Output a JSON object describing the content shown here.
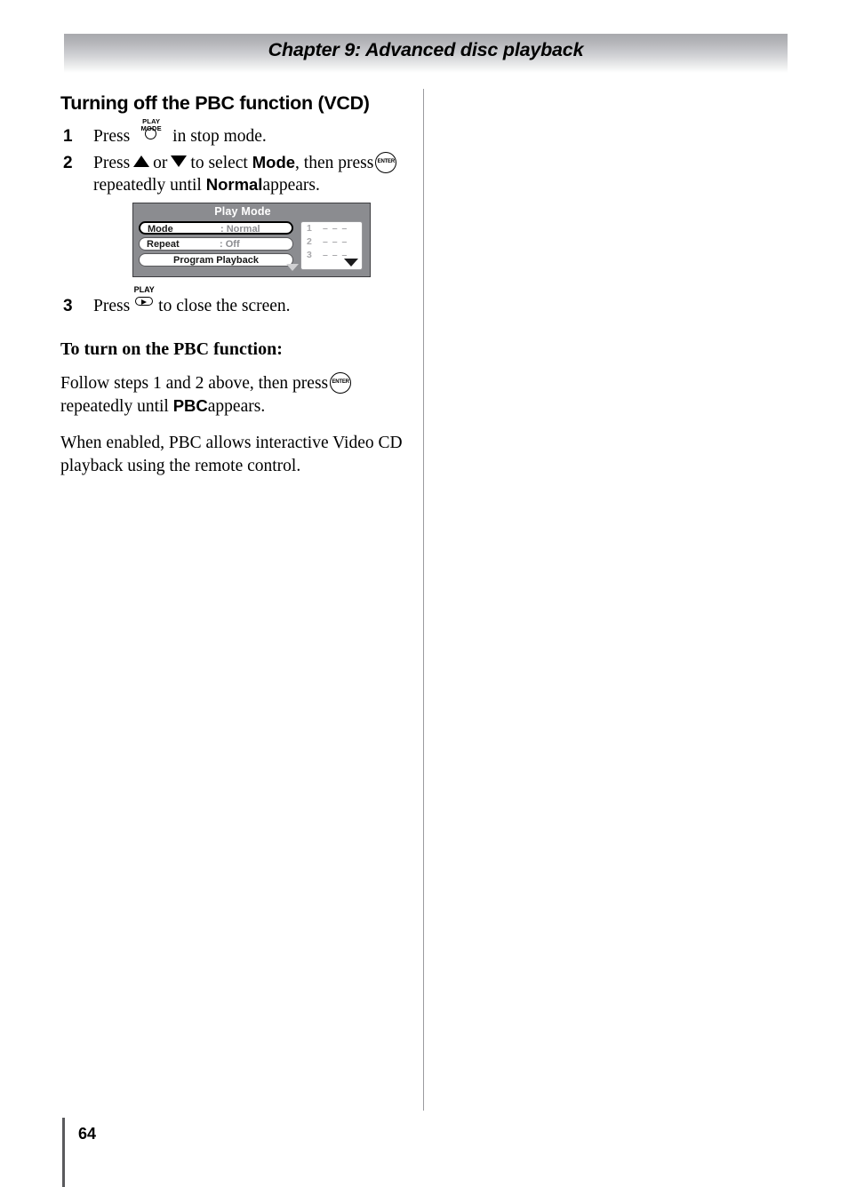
{
  "header": {
    "chapter_title": "Chapter 9: Advanced disc playback"
  },
  "section": {
    "title": "Turning off the PBC function (VCD)"
  },
  "steps": [
    {
      "number": "1",
      "text_before": "Press",
      "key": "PLAY MODE",
      "text_after": "in stop mode."
    },
    {
      "number": "2",
      "text_before": "Press",
      "arrow_up": "up-arrow",
      "conjunction": "or",
      "arrow_down": "down-arrow",
      "text_mid": "to select",
      "target": "Mode",
      "text_mid2": ", then press",
      "key": "ENTER",
      "text_after": "repeatedly until",
      "target2": "Normal",
      "text_end": "appears."
    },
    {
      "number": "3",
      "text_before": "Press",
      "key": "PLAY",
      "text_after": "to close the screen."
    }
  ],
  "osd": {
    "title": "Play Mode",
    "rows": [
      {
        "label": "Mode",
        "value": ": Normal",
        "selected": true
      },
      {
        "label": "Repeat",
        "value": ": Off",
        "selected": false
      }
    ],
    "button": "Program Playback",
    "program_list": [
      {
        "index": "1",
        "value": "– – –"
      },
      {
        "index": "2",
        "value": "– – –"
      },
      {
        "index": "3",
        "value": "– – –"
      }
    ]
  },
  "turn_on": {
    "subhead": "To turn on the PBC function:",
    "para1_before": "Follow steps 1 and 2 above, then press",
    "para1_key": "ENTER",
    "para1_after": "repeatedly until",
    "para1_bold": "PBC",
    "para1_end": "appears.",
    "para2": "When enabled, PBC allows interactive Video CD playback using the remote control."
  },
  "folio": {
    "page_number": "64"
  },
  "keys": {
    "play_mode_caption": "PLAY MODE",
    "play_caption": "PLAY",
    "enter_caption": "ENTER"
  }
}
